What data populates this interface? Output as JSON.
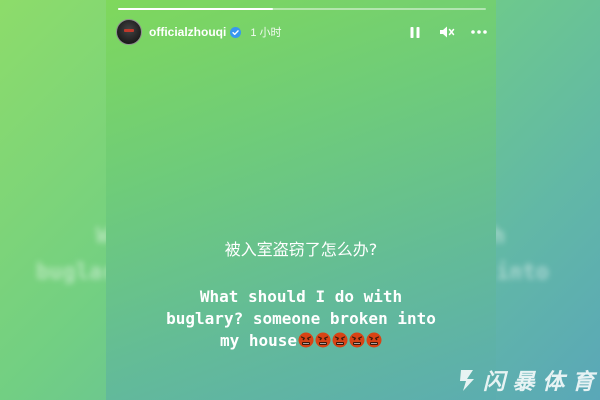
{
  "story": {
    "username": "officialzhouqi",
    "time_ago": "1 小时",
    "progress": 0.42,
    "caption_zh": "被入室盗窃了怎么办?",
    "caption_en_line1": "What should I do with",
    "caption_en_line2": "buglary? someone broken into",
    "caption_en_line3": "my house",
    "emoji_count": 5
  },
  "controls": {
    "pause_icon": "pause-icon",
    "mute_icon": "mute-icon",
    "more_icon": "more-icon"
  },
  "background_blur": {
    "left_line1": "W",
    "left_line2": "buglary",
    "right_line1": "h",
    "right_line2": "into"
  },
  "watermark": {
    "text": "闪 暴 体 育"
  },
  "colors": {
    "accent": "#ffffff",
    "verified_blue": "#3897f0",
    "emoji_red": "#d84315"
  }
}
